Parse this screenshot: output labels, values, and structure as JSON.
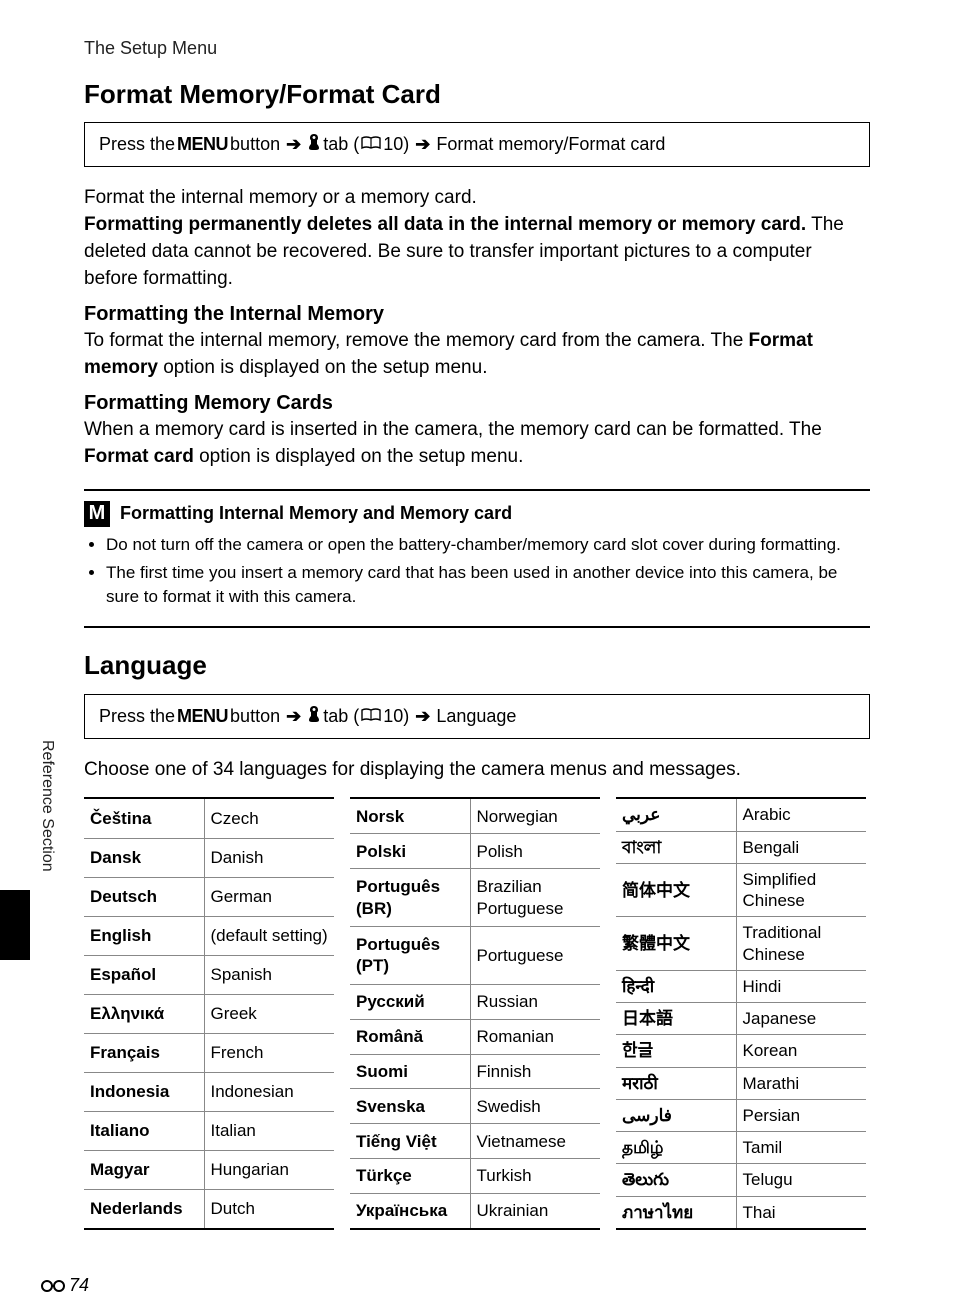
{
  "running_head": "The Setup Menu",
  "section1": {
    "title": "Format Memory/Format Card",
    "nav": {
      "prefix": "Press the ",
      "menu": "MENU",
      "between": " button",
      "tab": " tab (",
      "ref": "10)",
      "dest": "Format memory/Format card"
    },
    "p1_a": "Format the internal memory or a memory card.",
    "p1_b_bold": "Formatting permanently deletes all data in the internal memory or memory card.",
    "p1_b_rest": " The deleted data cannot be recovered. Be sure to transfer important pictures to a computer before formatting.",
    "h_internal": "Formatting the Internal Memory",
    "p_internal_a": "To format the internal memory, remove the memory card from the camera. The ",
    "p_internal_bold": "Format memory",
    "p_internal_b": " option is displayed on the setup menu.",
    "h_cards": "Formatting Memory Cards",
    "p_cards_a": "When a memory card is inserted in the camera, the memory card can be formatted. The ",
    "p_cards_bold": "Format card",
    "p_cards_b": " option is displayed on the setup menu.",
    "note_badge": "M",
    "note_title": "Formatting Internal Memory and Memory card",
    "note_items": [
      "Do not turn off the camera or open the battery-chamber/memory card slot cover during formatting.",
      "The first time you insert a memory card that has been used in another device into this camera, be sure to format it with this camera."
    ]
  },
  "section2": {
    "title": "Language",
    "nav": {
      "prefix": "Press the ",
      "menu": "MENU",
      "between": " button",
      "tab": " tab (",
      "ref": "10)",
      "dest": "Language"
    },
    "intro": "Choose one of 34 languages for displaying the camera menus and messages."
  },
  "lang_col1": [
    {
      "native": "Čeština",
      "name": "Czech"
    },
    {
      "native": "Dansk",
      "name": "Danish"
    },
    {
      "native": "Deutsch",
      "name": "German"
    },
    {
      "native": "English",
      "name": "(default setting)"
    },
    {
      "native": "Español",
      "name": "Spanish"
    },
    {
      "native": "Ελληνικά",
      "name": "Greek"
    },
    {
      "native": "Français",
      "name": "French"
    },
    {
      "native": "Indonesia",
      "name": "Indonesian"
    },
    {
      "native": "Italiano",
      "name": "Italian"
    },
    {
      "native": "Magyar",
      "name": "Hungarian"
    },
    {
      "native": "Nederlands",
      "name": "Dutch"
    }
  ],
  "lang_col2": [
    {
      "native": "Norsk",
      "name": "Norwegian"
    },
    {
      "native": "Polski",
      "name": "Polish"
    },
    {
      "native": "Português (BR)",
      "name": "Brazilian Portuguese"
    },
    {
      "native": "Português (PT)",
      "name": "Portuguese"
    },
    {
      "native": "Русский",
      "name": "Russian"
    },
    {
      "native": "Română",
      "name": "Romanian"
    },
    {
      "native": "Suomi",
      "name": "Finnish"
    },
    {
      "native": "Svenska",
      "name": "Swedish"
    },
    {
      "native": "Tiếng Việt",
      "name": "Vietnamese"
    },
    {
      "native": "Türkçe",
      "name": "Turkish"
    },
    {
      "native": "Українська",
      "name": "Ukrainian"
    }
  ],
  "lang_col3": [
    {
      "native": "عربي",
      "name": "Arabic"
    },
    {
      "native": "বাংলা",
      "name": "Bengali"
    },
    {
      "native": "简体中文",
      "name": "Simplified Chinese"
    },
    {
      "native": "繁體中文",
      "name": "Traditional Chinese"
    },
    {
      "native": "हिन्दी",
      "name": "Hindi"
    },
    {
      "native": "日本語",
      "name": "Japanese"
    },
    {
      "native": "한글",
      "name": "Korean"
    },
    {
      "native": "मराठी",
      "name": "Marathi"
    },
    {
      "native": "فارسی",
      "name": "Persian"
    },
    {
      "native": "தமிழ்",
      "name": "Tamil"
    },
    {
      "native": "తెలుగు",
      "name": "Telugu"
    },
    {
      "native": "ภาษาไทย",
      "name": "Thai"
    }
  ],
  "side_label": "Reference Section",
  "page_number": "74"
}
